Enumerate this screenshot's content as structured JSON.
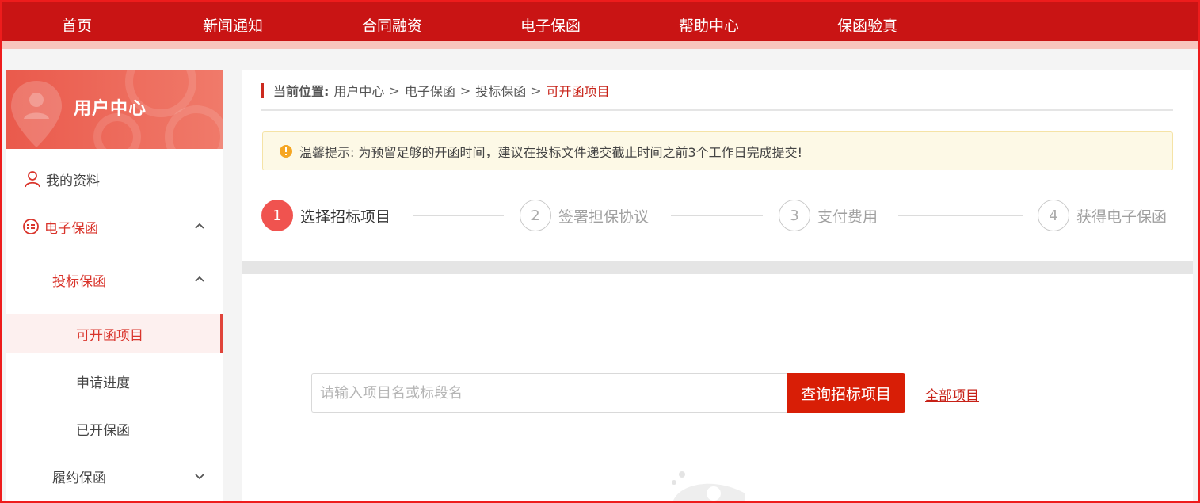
{
  "nav": {
    "items": [
      "首页",
      "新闻通知",
      "合同融资",
      "电子保函",
      "帮助中心",
      "保函验真"
    ]
  },
  "sidebar": {
    "title": "用户中心",
    "profile": "我的资料",
    "eguarantee": "电子保函",
    "bid_guarantee": "投标保函",
    "available_projects": "可开函项目",
    "progress": "申请进度",
    "issued": "已开保函",
    "performance_guarantee": "履约保函"
  },
  "breadcrumb": {
    "label": "当前位置:",
    "items": [
      "用户中心",
      "电子保函",
      "投标保函"
    ],
    "current": "可开函项目",
    "separator": ">"
  },
  "notice": {
    "text": "温馨提示: 为预留足够的开函时间，建议在投标文件递交截止时间之前3个工作日完成提交!"
  },
  "steps": [
    {
      "num": "1",
      "label": "选择招标项目"
    },
    {
      "num": "2",
      "label": "签署担保协议"
    },
    {
      "num": "3",
      "label": "支付费用"
    },
    {
      "num": "4",
      "label": "获得电子保函"
    }
  ],
  "search": {
    "placeholder": "请输入项目名或标段名",
    "button": "查询招标项目",
    "all_link": "全部项目"
  },
  "colors": {
    "brand_red": "#c91414",
    "accent": "#f0534f",
    "button_red": "#d81e06"
  }
}
